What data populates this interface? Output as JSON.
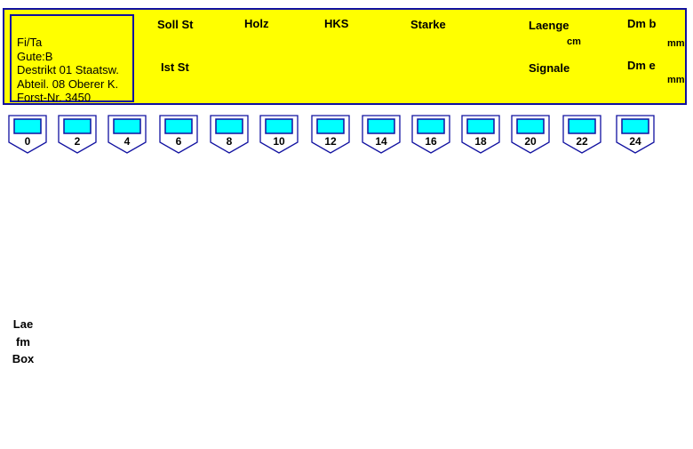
{
  "info": {
    "line1": "Fi/Ta",
    "line2": "Gute:B",
    "line3": "Destrikt 01 Staatsw.",
    "line4": "Abteil. 08 Oberer K.",
    "line5": "Forst-Nr. 3450"
  },
  "header": {
    "soll_st": "Soll St",
    "ist_st": "Ist St",
    "holz": "Holz",
    "hks": "HKS",
    "starke": "Starke",
    "laenge": "Laenge",
    "laenge_unit": "cm",
    "signale": "Signale",
    "dm_b": "Dm b",
    "dm_b_unit": "mm",
    "dm_e": "Dm e",
    "dm_e_unit": "mm"
  },
  "slots": [
    "0",
    "2",
    "4",
    "6",
    "8",
    "10",
    "12",
    "14",
    "16",
    "18",
    "20",
    "22",
    "24"
  ],
  "side": {
    "lae": "Lae",
    "fm": "fm",
    "box": "Box"
  },
  "colors": {
    "header_bg": "#ffff00",
    "border": "#1010a0",
    "slot_fill": "#00ffff"
  }
}
